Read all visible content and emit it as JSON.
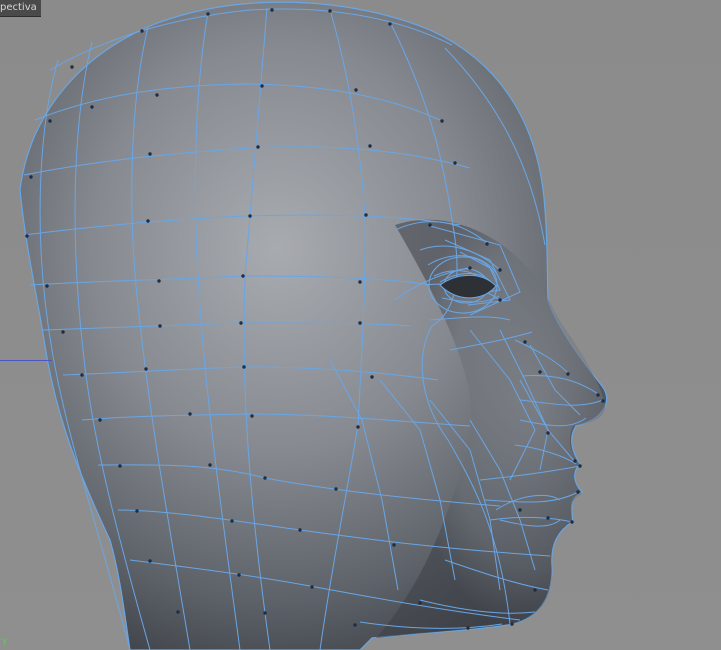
{
  "viewport": {
    "label": "pectiva",
    "axis": "Y"
  },
  "colors": {
    "background": "#8f8f8f",
    "mesh": "#69a6e6",
    "mesh_dark": "#4f8fd3",
    "label_bg": "#4a4a4a",
    "axis_y": "#55d14f",
    "axis_x": "#4b57c7"
  },
  "icons": {
    "axis_indicator": "axis-indicator-icon"
  }
}
